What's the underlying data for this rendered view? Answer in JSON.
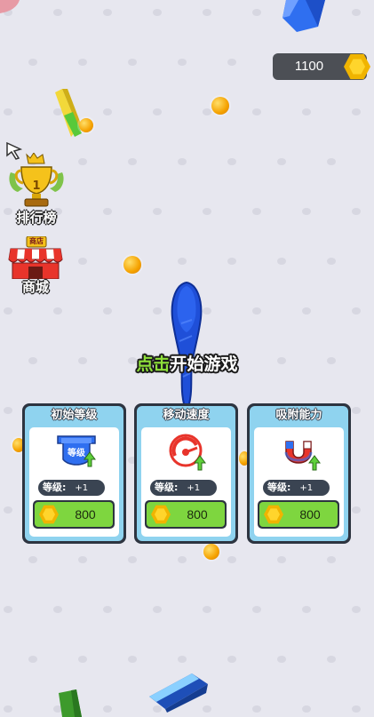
{
  "balance": {
    "value": "1100",
    "icon": "coin-icon"
  },
  "menu": {
    "leaderboard": {
      "label": "排行榜",
      "rank": "1",
      "icon": "trophy-icon"
    },
    "shop": {
      "label": "商城",
      "sign": "商店",
      "icon": "shop-icon"
    }
  },
  "start_hint": {
    "highlight": "点击",
    "rest": "开始游戏"
  },
  "upgrades": [
    {
      "title": "初始等级",
      "badge": "等级",
      "level_label": "等级:",
      "level_value": "+1",
      "price": "800",
      "icon": "level-shield-icon"
    },
    {
      "title": "移动速度",
      "level_label": "等级:",
      "level_value": "+1",
      "price": "800",
      "icon": "speedometer-icon"
    },
    {
      "title": "吸附能力",
      "level_label": "等级:",
      "level_value": "+1",
      "price": "800",
      "icon": "magnet-icon"
    }
  ],
  "colors": {
    "background": "#e7e7ef",
    "card_frame": "#2d3440",
    "card_header": "#8fd3ef",
    "price_button": "#7ed63f",
    "coin": "#ffd52c",
    "snake": "#1f4fd8",
    "highlight_text": "#8ee03a"
  }
}
